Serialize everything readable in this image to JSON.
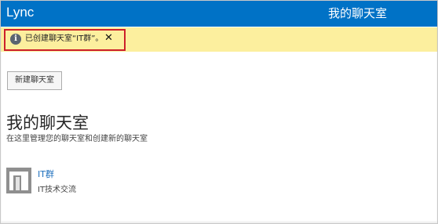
{
  "app": {
    "title": "Lync",
    "page_heading": "我的聊天室"
  },
  "notification": {
    "icon": "info-icon",
    "icon_glyph": "i",
    "text": "已创建聊天室“IT群”。",
    "close_glyph": "✕"
  },
  "toolbar": {
    "new_room_label": "新建聊天室"
  },
  "section": {
    "title": "我的聊天室",
    "subtitle": "在这里管理您的聊天室和创建新的聊天室"
  },
  "rooms": [
    {
      "name": "IT群",
      "description": "IT技术交流",
      "avatar": "chatroom-avatar-icon"
    }
  ],
  "colors": {
    "top_bar": "#0072c6",
    "notification_bar": "#fcef9e",
    "highlight_border": "#cc1f2b",
    "link": "#1d6fbd",
    "avatar": "#8f8f8f"
  }
}
